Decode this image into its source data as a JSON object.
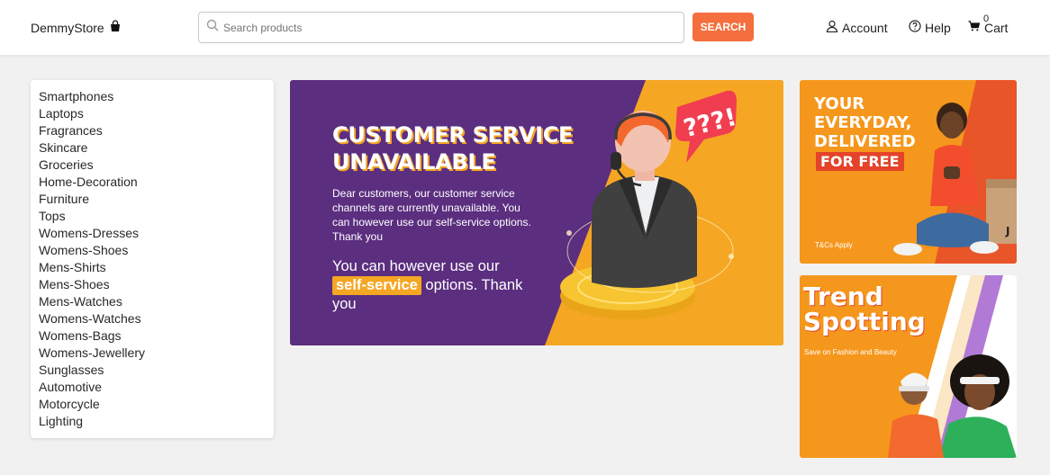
{
  "header": {
    "logo_text": "DemmyStore",
    "search_placeholder": "Search products",
    "search_button": "SEARCH",
    "account_label": "Account",
    "help_label": "Help",
    "cart_label": "Cart",
    "cart_count": "0"
  },
  "sidebar": {
    "items": [
      {
        "label": "Smartphones"
      },
      {
        "label": "Laptops"
      },
      {
        "label": "Fragrances"
      },
      {
        "label": "Skincare"
      },
      {
        "label": "Groceries"
      },
      {
        "label": "Home-Decoration"
      },
      {
        "label": "Furniture"
      },
      {
        "label": "Tops"
      },
      {
        "label": "Womens-Dresses"
      },
      {
        "label": "Womens-Shoes"
      },
      {
        "label": "Mens-Shirts"
      },
      {
        "label": "Mens-Shoes"
      },
      {
        "label": "Mens-Watches"
      },
      {
        "label": "Womens-Watches"
      },
      {
        "label": "Womens-Bags"
      },
      {
        "label": "Womens-Jewellery"
      },
      {
        "label": "Sunglasses"
      },
      {
        "label": "Automotive"
      },
      {
        "label": "Motorcycle"
      },
      {
        "label": "Lighting"
      }
    ]
  },
  "banner": {
    "title_line1": "CUSTOMER SERVICE",
    "title_line2": "UNAVAILABLE",
    "body": "Dear customers, our customer service channels are currently unavailable. You can however use our self-service options. Thank you",
    "cta_before": "You can however use our",
    "cta_highlight": "self-service",
    "cta_after": "options. Thank you",
    "bubble_text": "???!"
  },
  "promo1": {
    "line1": "YOUR",
    "line2": "EVERYDAY,",
    "line3": "DELIVERED",
    "free": "FOR FREE",
    "tc": "T&Cs Apply"
  },
  "promo2": {
    "line1": "Trend",
    "line2": "Spotting",
    "sub": "Save on Fashion and Beauty"
  },
  "colors": {
    "accent": "#f46f3d",
    "banner_purple": "#5b2e7f",
    "banner_orange": "#f5a623",
    "promo_orange": "#f5971d"
  }
}
